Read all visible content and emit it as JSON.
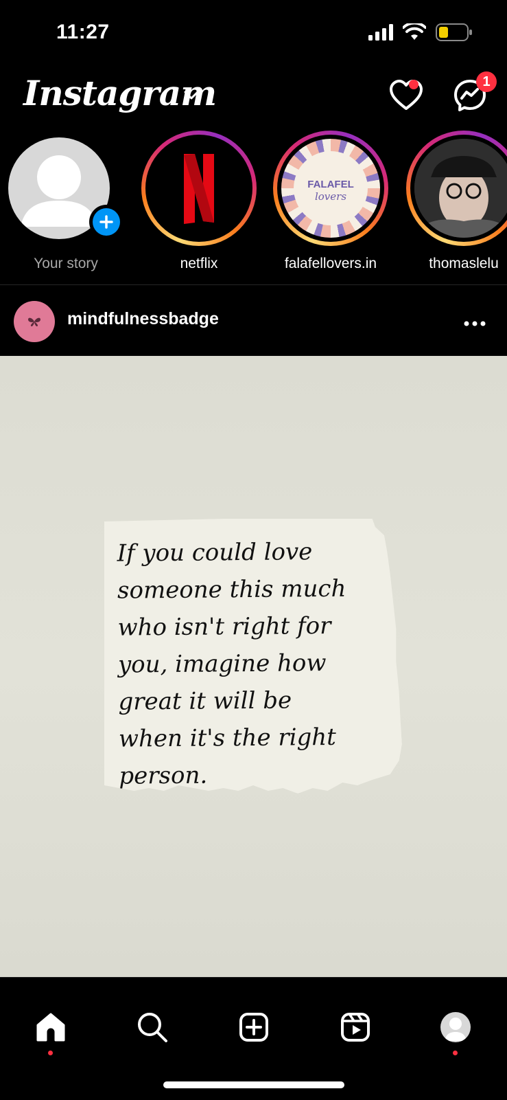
{
  "status_bar": {
    "time": "11:27",
    "icons": [
      "cellular-signal-icon",
      "wifi-icon",
      "battery-low-icon"
    ],
    "battery_color": "#f5d000"
  },
  "header": {
    "logo_text": "Instagram",
    "icons": [
      "chevron-down-icon",
      "heart-icon",
      "messenger-icon"
    ],
    "messenger_badge": "1",
    "notification_color": "#ff3040"
  },
  "stories": [
    {
      "label": "Your story",
      "type": "own",
      "add_icon": "plus-icon"
    },
    {
      "label": "netflix",
      "type": "brand"
    },
    {
      "label": "falafellovers.in",
      "type": "brand",
      "logo_text_1": "FALAFEL",
      "logo_text_2": "lovers"
    },
    {
      "label": "thomaslelu",
      "type": "person"
    }
  ],
  "post": {
    "username": "mindfulnessbadge",
    "more_icon": "more-horizontal-icon",
    "note_text": "If you could love\nsomeone this much\nwho isn't right for\nyou, imagine how\ngreat it will be\nwhen it's the right\n        person."
  },
  "bottom_nav": {
    "items": [
      "home-icon",
      "search-icon",
      "create-post-icon",
      "reels-icon",
      "profile-avatar"
    ],
    "active": "home-icon"
  }
}
